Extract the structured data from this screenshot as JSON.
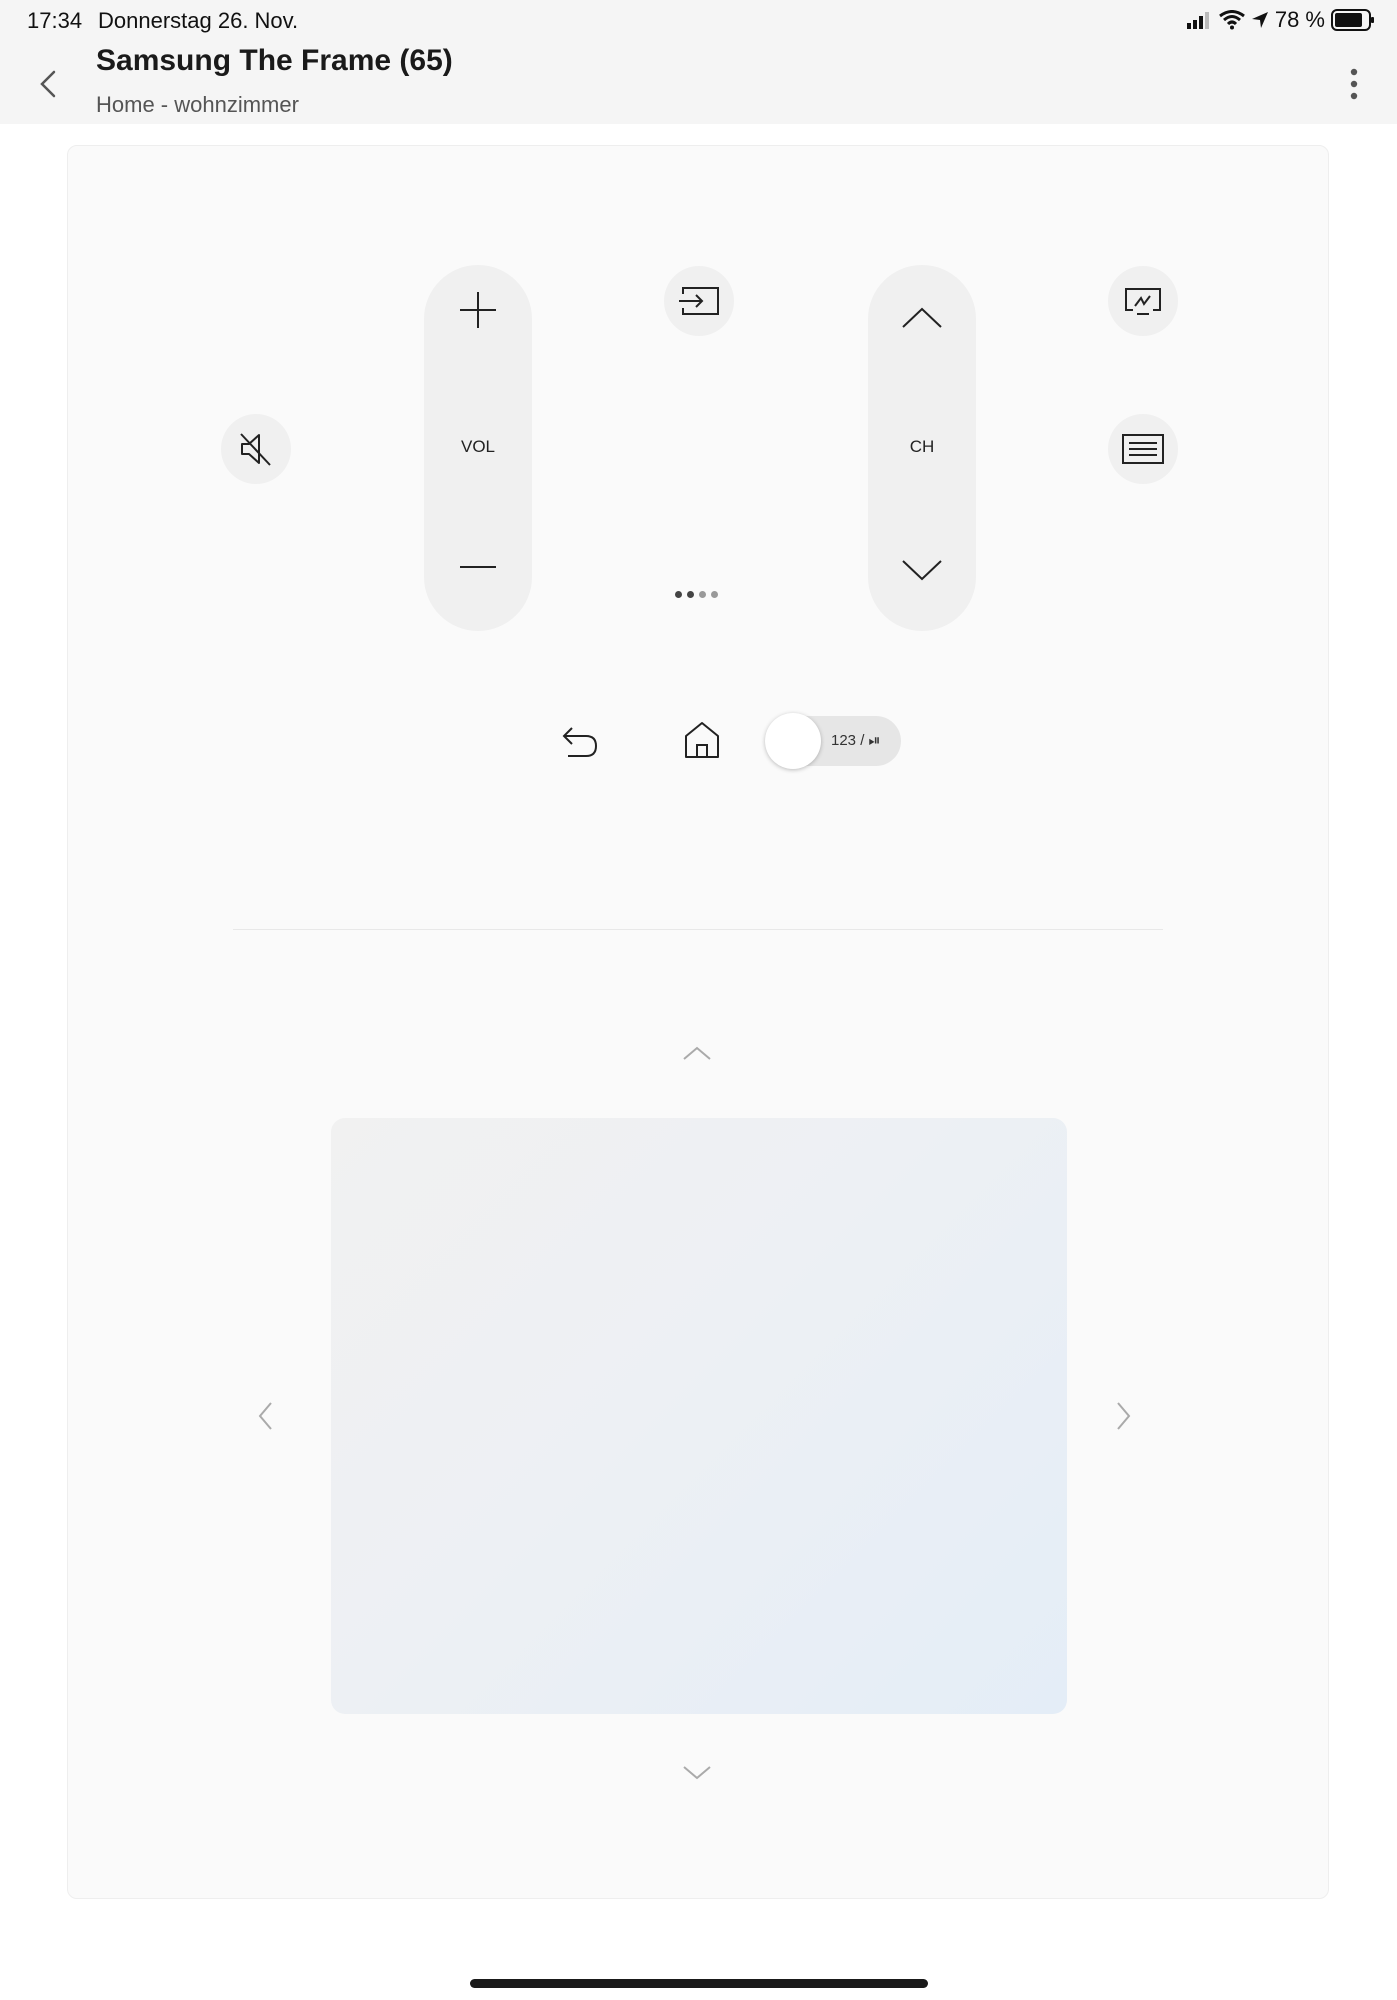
{
  "status_bar": {
    "time": "17:34",
    "date": "Donnerstag 26. Nov.",
    "battery": "78 %"
  },
  "header": {
    "title": "Samsung The Frame (65)",
    "subtitle": "Home - wohnzimmer"
  },
  "remote": {
    "volume_label": "VOL",
    "channel_label": "CH",
    "toggle_label": "123 / ⏯"
  },
  "icons": {
    "back": "chevron-left-icon",
    "more": "more-vertical-icon",
    "mute": "mute-icon",
    "source": "source-icon",
    "cast": "screen-mirror-icon",
    "guide": "guide-icon",
    "return": "return-icon",
    "home": "home-icon"
  },
  "colors": {
    "background": "#ffffff",
    "header": "#f5f5f5",
    "button": "#f0f0f0",
    "touchpad_start": "#f1f1f1",
    "touchpad_end": "#e4edf7"
  }
}
